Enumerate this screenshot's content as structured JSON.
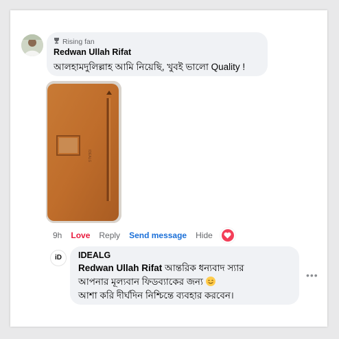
{
  "comment": {
    "badge": "Rising fan",
    "author": "Redwan Ullah Rifat",
    "text": "আলহামদুলিল্লাহ আমি নিয়েছি, খুবই ভালো Quality !"
  },
  "actions": {
    "time": "9h",
    "love": "Love",
    "reply": "Reply",
    "send_message": "Send message",
    "hide": "Hide"
  },
  "reply": {
    "avatar_text": "iD",
    "author": "IDEALG",
    "mention": "Redwan Ullah Rifat",
    "line1_rest": " আন্তরিক ধন্যবাদ স্যার",
    "line2": "আপনার মূল্যবান ফিডব্যাকের জন্য ",
    "line3": "আশা করি দীর্ঘদিন নিশ্চিন্তে ব্যবহার করবেন।"
  },
  "icons": {
    "badge": "trophy-icon",
    "reaction": "heart-icon",
    "emoji": "smiling-face-emoji",
    "more": "more-options-icon"
  },
  "colors": {
    "love": "#e8193c",
    "send_message": "#1a6fd8",
    "bubble": "#f0f2f5",
    "product": "#c0712e"
  }
}
